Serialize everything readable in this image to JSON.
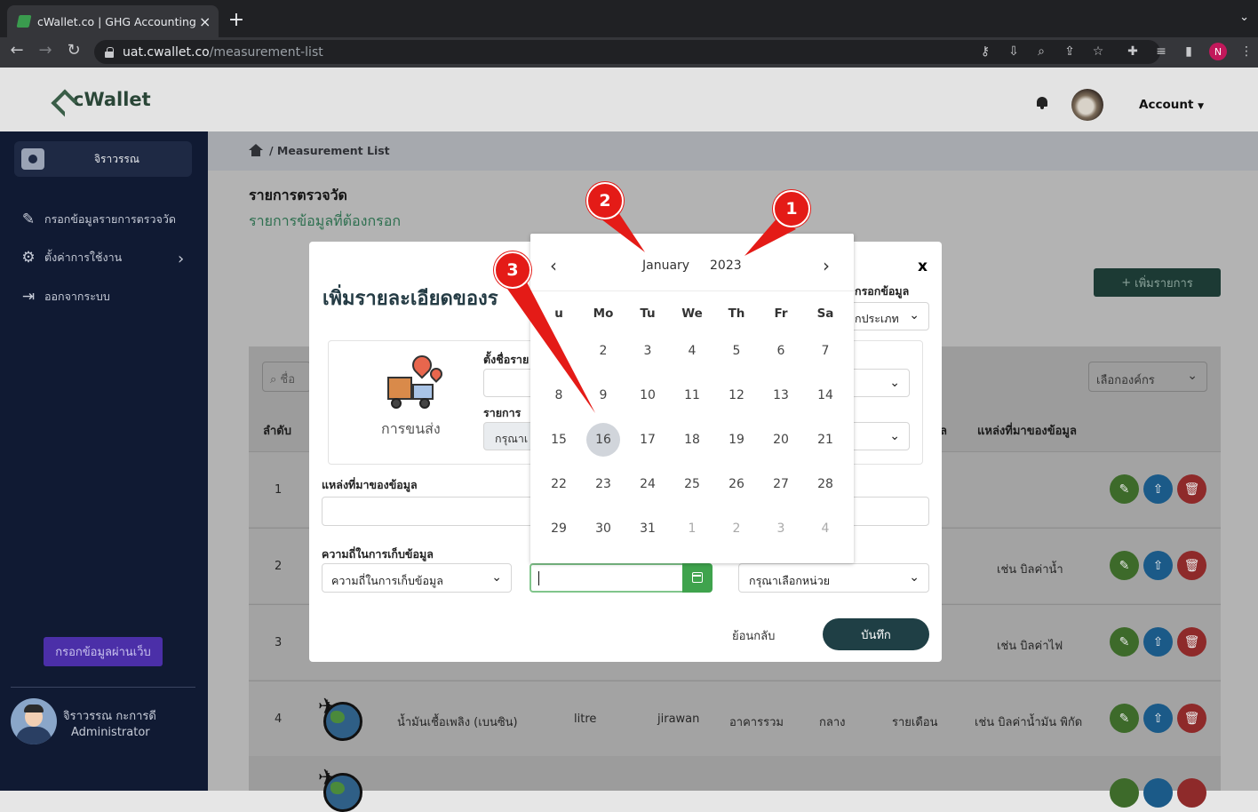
{
  "browser": {
    "tab_title": "cWallet.co | GHG Accounting S",
    "url_host": "uat.cwallet.co",
    "url_path": "/measurement-list",
    "profile_initial": "N"
  },
  "header": {
    "logo_text": "cWallet",
    "account_label": "Account"
  },
  "sidebar": {
    "user_short": "จิราวรรณ",
    "items": [
      {
        "label": "กรอกข้อมูลรายการตรวจวัด",
        "icon": "pencil-icon"
      },
      {
        "label": "ตั้งค่าการใช้งาน",
        "icon": "gear-icon"
      },
      {
        "label": "ออกจากระบบ",
        "icon": "logout-icon"
      }
    ],
    "web_button": "กรอกข้อมูลผ่านเว็บ",
    "user_name": "จิราวรรณ กะการดี",
    "user_role": "Administrator"
  },
  "page": {
    "breadcrumb": "Measurement List",
    "title": "รายการตรวจวัด",
    "subtitle": "รายการข้อมูลที่ต้องกรอก",
    "add_button": "เพิ่มรายการ",
    "search_placeholder": "ชื่อ",
    "org_select": "เลือกองค์กร"
  },
  "table": {
    "col_no": "ลำดับ",
    "col_col": "ล",
    "col_source": "แหล่งที่มาของข้อมูล",
    "rows": [
      {
        "no": "1",
        "source": ""
      },
      {
        "no": "2",
        "source": "เช่น บิลค่าน้ำ"
      },
      {
        "no": "3",
        "source": "เช่น บิลค่าไฟ"
      },
      {
        "no": "4",
        "name": "น้ำมันเชื้อเพลิง (เบนซิน)",
        "unit": "litre",
        "user": "jirawan",
        "building": "อาคารรวม",
        "level": "กลาง",
        "freq": "รายเดือน",
        "source": "เช่น บิลค่าน้ำมัน พิกัด"
      }
    ]
  },
  "modal": {
    "title": "เพิ่มรายละเอียดของร",
    "close": "x",
    "type_label": "กรอกข้อมูล",
    "type_value": "กประเภท",
    "category": "การขนส่ง",
    "set_name_label": "ตั้งชื่อราย",
    "item_label": "รายการ",
    "item_value": "กรุณาเ",
    "source_label": "แหล่งที่มาของข้อมูล",
    "freq_label": "ความถี่ในการเก็บข้อมูล",
    "freq_value": "ความถี่ในการเก็บข้อมูล",
    "unit_value": "กรุณาเลือกหน่วย",
    "back": "ย้อนกลับ",
    "save": "บันทึก"
  },
  "datepicker": {
    "month": "January",
    "year": "2023",
    "weekdays": [
      "u",
      "Mo",
      "Tu",
      "We",
      "Th",
      "Fr",
      "Sa"
    ],
    "weeks": [
      [
        "",
        "2",
        "3",
        "4",
        "5",
        "6",
        "7"
      ],
      [
        "8",
        "9",
        "10",
        "11",
        "12",
        "13",
        "14"
      ],
      [
        "15",
        "16",
        "17",
        "18",
        "19",
        "20",
        "21"
      ],
      [
        "22",
        "23",
        "24",
        "25",
        "26",
        "27",
        "28"
      ],
      [
        "29",
        "30",
        "31",
        "1",
        "2",
        "3",
        "4"
      ]
    ],
    "selected": "16"
  },
  "annotations": [
    "1",
    "2",
    "3"
  ],
  "colors": {
    "annotation": "#e41b17",
    "sidebar": "#101a33",
    "save_button": "#1f3f45",
    "date_button": "#3fa34d"
  }
}
